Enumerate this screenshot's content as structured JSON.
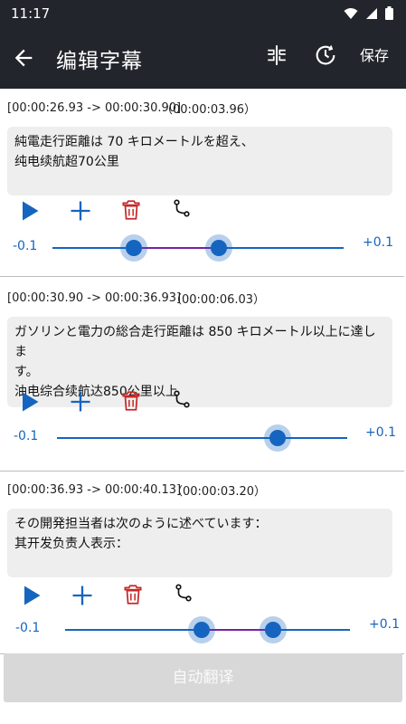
{
  "status": {
    "time": "11:17"
  },
  "header": {
    "title": "编辑字幕",
    "save_label": "保存"
  },
  "segments": [
    {
      "range": "[00:00:26.93 -> 00:00:30.90]",
      "duration": "（00:00:03.96）",
      "text_lines": [
        "純電走行距離は 70 キロメートルを超え、",
        "纯电续航超70公里"
      ],
      "slider_min": "-0.1",
      "slider_max": "+0.1",
      "slider_start": 0.28,
      "slider_end": 0.57
    },
    {
      "range": "[00:00:30.90 -> 00:00:36.93]",
      "duration": "（00:00:06.03）",
      "text_lines": [
        "ガソリンと電力の総合走行距離は 850 キロメートル以上に達しま",
        "す。",
        "油电综合续航达850公里以上"
      ],
      "slider_min": "-0.1",
      "slider_max": "+0.1",
      "slider_start": 0.76,
      "slider_end": 0.76
    },
    {
      "range": "[00:00:36.93 -> 00:00:40.13]",
      "duration": "（00:00:03.20）",
      "text_lines": [
        "その開発担当者は次のように述べています：",
        "其开发负责人表示："
      ],
      "slider_min": "-0.1",
      "slider_max": "+0.1",
      "slider_start": 0.48,
      "slider_end": 0.73
    }
  ],
  "footer": {
    "translate_label": "自动翻译"
  },
  "colors": {
    "accent": "#1565c0",
    "danger": "#c62828",
    "range": "#7b1fa2",
    "appbar": "#22252b"
  }
}
